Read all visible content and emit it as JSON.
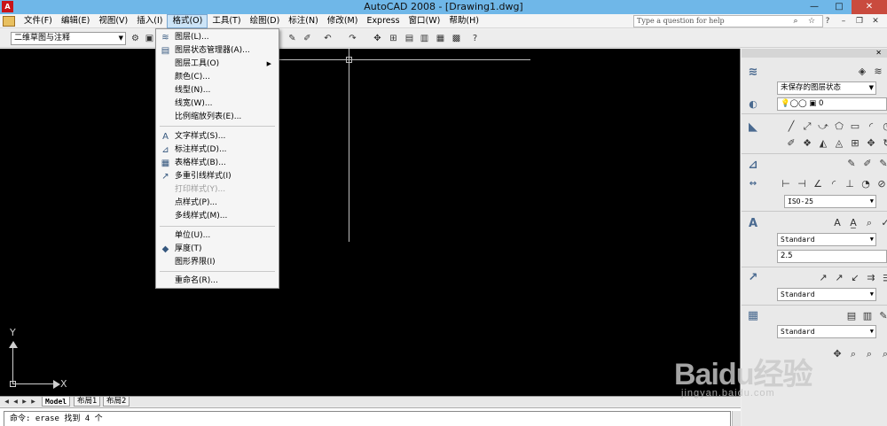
{
  "window": {
    "title": "AutoCAD 2008 - [Drawing1.dwg]",
    "app_icon_label": "A",
    "controls": {
      "minimize": "—",
      "maximize": "□",
      "close": "✕"
    }
  },
  "menubar": {
    "items": [
      {
        "label": "文件(F)"
      },
      {
        "label": "编辑(E)"
      },
      {
        "label": "视图(V)"
      },
      {
        "label": "插入(I)"
      },
      {
        "label": "格式(O)"
      },
      {
        "label": "工具(T)"
      },
      {
        "label": "绘图(D)"
      },
      {
        "label": "标注(N)"
      },
      {
        "label": "修改(M)"
      },
      {
        "label": "Express"
      },
      {
        "label": "窗口(W)"
      },
      {
        "label": "帮助(H)"
      }
    ],
    "help_placeholder": "Type a question for help"
  },
  "toolbar": {
    "workspace": "二维草图与注释"
  },
  "format_menu": {
    "items": [
      {
        "label": "图层(L)...",
        "icon": "layers-icon",
        "glyph": "≋"
      },
      {
        "label": "图层状态管理器(A)...",
        "icon": "layer-state-icon",
        "glyph": "▤"
      },
      {
        "label": "图层工具(O)",
        "submenu": true
      },
      {
        "label": "颜色(C)..."
      },
      {
        "label": "线型(N)..."
      },
      {
        "label": "线宽(W)..."
      },
      {
        "label": "比例缩放列表(E)..."
      },
      {
        "label": "文字样式(S)...",
        "icon": "text-style-icon",
        "glyph": "A"
      },
      {
        "label": "标注样式(D)...",
        "icon": "dim-style-icon",
        "glyph": "⊿"
      },
      {
        "label": "表格样式(B)...",
        "icon": "table-style-icon",
        "glyph": "▦"
      },
      {
        "label": "多重引线样式(I)",
        "icon": "mleader-style-icon",
        "glyph": "↗"
      },
      {
        "label": "打印样式(Y)...",
        "disabled": true
      },
      {
        "label": "点样式(P)..."
      },
      {
        "label": "多线样式(M)..."
      },
      {
        "label": "单位(U)..."
      },
      {
        "label": "厚度(T)",
        "icon": "thickness-icon",
        "glyph": "◆"
      },
      {
        "label": "图形界限(I)"
      },
      {
        "label": "重命名(R)..."
      }
    ],
    "submenu_arrow": "▶"
  },
  "canvas": {
    "ucs_x": "X",
    "ucs_y": "Y"
  },
  "layout_tabs": {
    "nav": [
      "◀",
      "◀",
      "▶",
      "▶"
    ],
    "tabs": [
      {
        "label": "Model",
        "active": true
      },
      {
        "label": "布局1"
      },
      {
        "label": "布局2"
      }
    ]
  },
  "command": {
    "text": "命令:  erase 找到 4 个"
  },
  "dashboard": {
    "close": "✕",
    "layer_state": "未保存的图层状态",
    "layer_current": "0",
    "dim_style": "ISO-25",
    "text_style": "Standard",
    "text_height": "2.5",
    "mleader_style": "Standard",
    "table_style": "Standard"
  },
  "watermark": {
    "brand": "Bai",
    "brand_paw": "du",
    "brand_cn": "经验",
    "sub": "jingyan.baidu.com"
  }
}
